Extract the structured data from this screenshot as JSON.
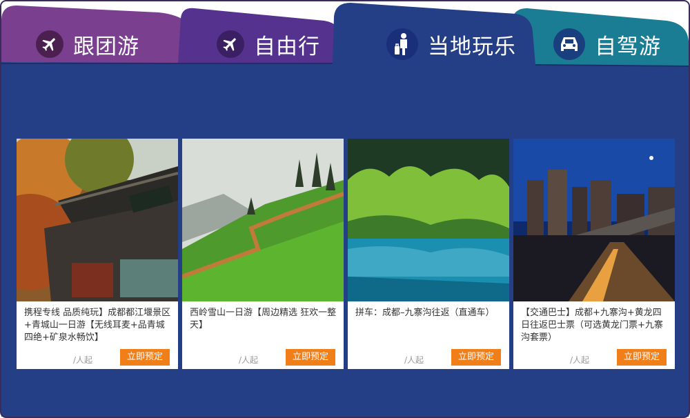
{
  "tabs": [
    {
      "label": "跟团游",
      "icon": "airplane-icon",
      "icon_bg": "#4b2050"
    },
    {
      "label": "自由行",
      "icon": "airplane-icon",
      "icon_bg": "#3a1f63"
    },
    {
      "label": "当地玩乐",
      "icon": "traveler-icon",
      "icon_bg": "#1a2f7a",
      "active": true
    },
    {
      "label": "自驾游",
      "icon": "car-icon",
      "icon_bg": "#1a3f7e"
    }
  ],
  "colors": {
    "panel": "#253f87",
    "tab_group": "#7a3f8f",
    "tab_free": "#55328d",
    "tab_local": "#253f87",
    "tab_drive": "#1a7d93",
    "book_button": "#f07f1a"
  },
  "products": [
    {
      "title": "携程专线  品质纯玩】成都都江堰景区+青城山一日游【无线耳麦+品青城四绝+矿泉水畅饮】",
      "price_suffix": "/人起",
      "button": "立即预定",
      "photo": "temple-autumn"
    },
    {
      "title": "西岭雪山一日游【周边精选  狂欢一整天】",
      "price_suffix": "/人起",
      "button": "立即预定",
      "photo": "mountain-stairway"
    },
    {
      "title": "拼车：成都–九寨沟往返（直通车）",
      "price_suffix": "/人起",
      "button": "立即预定",
      "photo": "jiuzhaigou-lake"
    },
    {
      "title": "【交通巴士】成都+九寨沟+黄龙四日往返巴士票（可选黄龙门票+九寨沟套票）",
      "price_suffix": "/人起",
      "button": "立即预定",
      "photo": "city-night-bridge"
    }
  ]
}
